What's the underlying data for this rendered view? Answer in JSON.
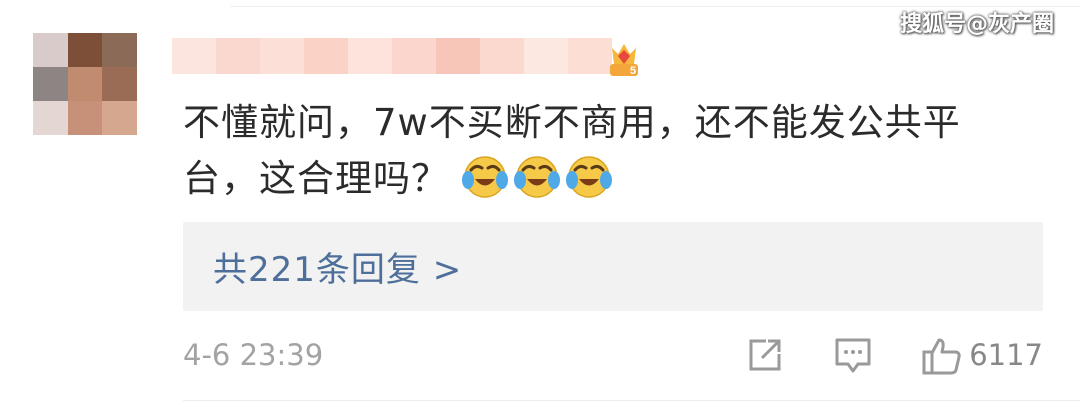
{
  "watermark": "搜狐号@灰产圈",
  "comment": {
    "text": "不懂就问，7w不买断不商用，还不能发公共平台，这合理吗？",
    "emojis": [
      "laugh-cry-emoji",
      "laugh-cry-emoji",
      "laugh-cry-emoji"
    ]
  },
  "replies": {
    "label": "共221条回复 >"
  },
  "footer": {
    "timestamp": "4-6 23:39",
    "like_count": "6117"
  },
  "colors": {
    "reply_link": "#4d6f99",
    "meta_gray": "#a3a3a3",
    "text": "#2b2b2b",
    "reply_bg": "#f2f2f2"
  },
  "icons": [
    "share-icon",
    "comment-icon",
    "thumbs-up-icon",
    "level-badge-icon"
  ]
}
